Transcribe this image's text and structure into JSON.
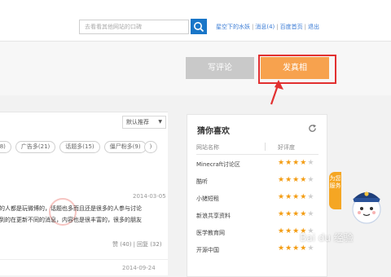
{
  "header": {
    "search_placeholder": "去看看其他网站的口碑",
    "user_links": [
      "星空下的水妖",
      "消息(4)",
      "百度首页",
      "退出"
    ]
  },
  "actions": {
    "comment_label": "写评论",
    "post_label": "发真相"
  },
  "feed": {
    "sort_label": "默认推荐",
    "tags": [
      "(8)",
      "广告多(21)",
      "话题多(15)",
      "僵尸粉多(9)",
      ")"
    ],
    "post": {
      "date": "2014-03-05",
      "line1": "的人都是玩微博的，话题也多而且还是很多的人参与讨论",
      "line2": "到的在更新不同的消息，内容也是很丰富的，很多的朋友",
      "like": "赞 (40)",
      "reply": "回复 (32)"
    },
    "post2_date": "2014-09-24"
  },
  "sidebar": {
    "title": "猜你喜欢",
    "col_name": "网站名称",
    "col_rating": "好评度",
    "sites": [
      {
        "name": "Minecraft讨论区",
        "stars": 4
      },
      {
        "name": "酷听",
        "stars": 4
      },
      {
        "name": "小猪短租",
        "stars": 4
      },
      {
        "name": "新浪共享资料",
        "stars": 4
      },
      {
        "name": "医学教育网",
        "stars": 4
      },
      {
        "name": "开源中国",
        "stars": 4
      }
    ]
  },
  "survey_tab": "为您服务",
  "watermark": "Bai du 经验",
  "colors": {
    "accent": "#1976c8",
    "orange": "#f7a24e",
    "highlight": "#e23030",
    "star": "#f39c12"
  }
}
